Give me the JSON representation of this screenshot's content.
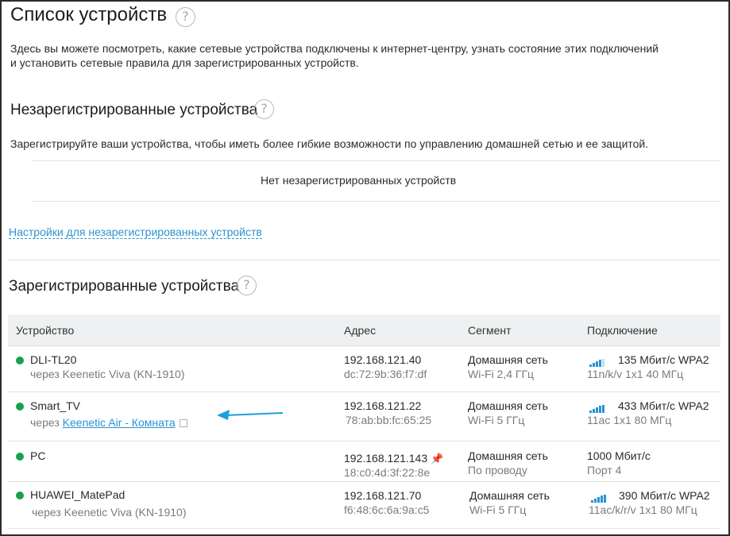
{
  "page": {
    "title": "Список устройств",
    "help_glyph": "?",
    "description_line1": "Здесь вы можете посмотреть, какие сетевые устройства подключены к интернет-центру, узнать состояние этих подключений",
    "description_line2": "и установить сетевые правила для зарегистрированных устройств."
  },
  "unregistered": {
    "title": "Незарегистрированные устройства",
    "description": "Зарегистрируйте ваши устройства, чтобы иметь более гибкие возможности по управлению домашней сетью и ее защитой.",
    "empty_text": "Нет незарегистрированных устройств",
    "settings_link": "Настройки для незарегистрированных устройств"
  },
  "registered": {
    "title": "Зарегистрированные устройства",
    "columns": [
      "Устройство",
      "Адрес",
      "Сегмент",
      "Подключение"
    ],
    "rows": [
      {
        "name": "DLI-TL20",
        "via_prefix": "через Keenetic Viva (KN-1910)",
        "ip": "192.168.121.40",
        "mac": "dc:72:9b:36:f7:df",
        "segment": "Домашняя сеть",
        "segment_sub": "Wi-Fi 2,4 ГГц",
        "connection": "135 Мбит/с WPA2",
        "connection_sub": "11n/k/v 1x1 40 МГц",
        "signal_icon": "wifi-signal-icon",
        "status_color": "#1aa04b"
      },
      {
        "name": "Smart_TV",
        "via_prefix": "через",
        "via_link": "Keenetic Air - Комната",
        "ip": "192.168.121.22",
        "mac": "78:ab:bb:fc:65:25",
        "segment": "Домашняя сеть",
        "segment_sub": "Wi-Fi 5 ГГц",
        "connection": "433 Мбит/с WPA2",
        "connection_sub": "11ac 1x1 80 МГц",
        "signal_icon": "wifi-signal-icon",
        "status_color": "#1aa04b"
      },
      {
        "name": "PC",
        "ip": "192.168.121.143",
        "mac": "18:c0:4d:3f:22:8e",
        "segment": "Домашняя сеть",
        "segment_sub": "По проводу",
        "connection": "1000 Мбит/с",
        "connection_sub": "Порт 4",
        "status_color": "#1aa04b"
      },
      {
        "name": "HUAWEI_MatePad",
        "via_prefix": "через Keenetic Viva (KN-1910)",
        "ip": "192.168.121.70",
        "mac": "f6:48:6c:6a:9a:c5",
        "segment": "Домашняя сеть",
        "segment_sub": "Wi-Fi 5 ГГц",
        "connection": "390 Мбит/с WPA2",
        "connection_sub": "11ac/k/r/v 1x1 80 МГц",
        "signal_icon": "wifi-signal-icon",
        "status_color": "#1aa04b"
      }
    ]
  },
  "colors": {
    "accent": "#2a92d3",
    "status_online": "#1aa04b",
    "annotation_arrow": "#1e9ee0"
  }
}
